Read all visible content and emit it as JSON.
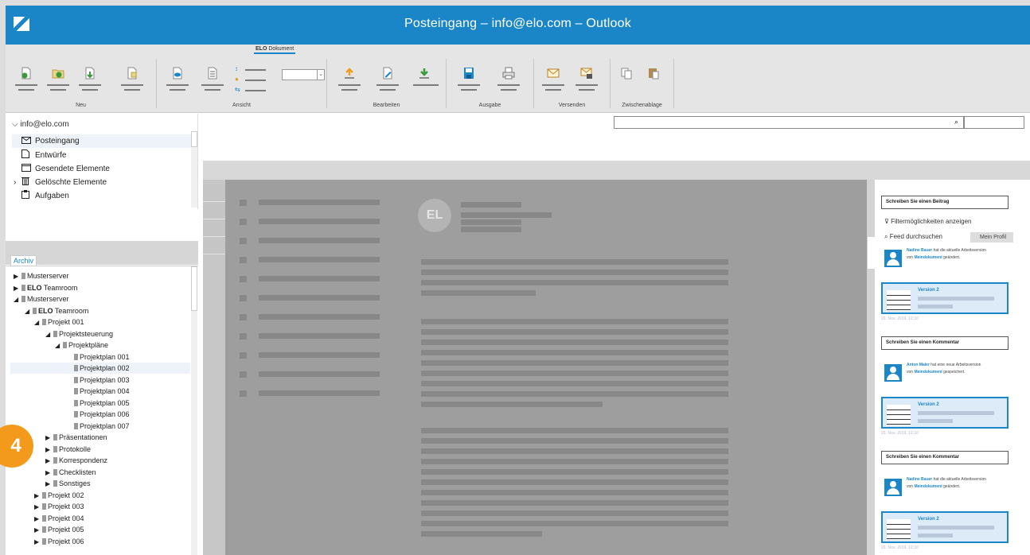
{
  "window": {
    "title": "Posteingang – info@elo.com – Outlook"
  },
  "ribbon": {
    "tab_bold": "ELO",
    "tab_rest": " Dokument",
    "groups": [
      "Neu",
      "Ansicht",
      "Bearbeiten",
      "Ausgabe",
      "Versenden",
      "Zwischenablage"
    ]
  },
  "folders": {
    "account": "info@elo.com",
    "items": [
      "Posteingang",
      "Entwürfe",
      "Gesendete Elemente",
      "Gelöschte Elemente",
      "Aufgaben"
    ]
  },
  "archive": {
    "tab": "Archiv",
    "tree": [
      {
        "label": "Musterserver",
        "bold": "",
        "arrow": "▶",
        "level": 0
      },
      {
        "label": " Teamroom",
        "bold": "ELO",
        "arrow": "▶",
        "level": 0
      },
      {
        "label": "Musterserver",
        "bold": "",
        "arrow": "◢",
        "level": 1
      },
      {
        "label": " Teamroom",
        "bold": "ELO",
        "arrow": "◢",
        "level": 2
      },
      {
        "label": "Projekt 001",
        "bold": "",
        "arrow": "◢",
        "level": 3
      },
      {
        "label": "Projektsteuerung",
        "bold": "",
        "arrow": "◢",
        "level": 4
      },
      {
        "label": "Projektpläne",
        "bold": "",
        "arrow": "◢",
        "level": 5
      },
      {
        "label": "Projektplan 001",
        "bold": "",
        "arrow": "",
        "level": 6
      },
      {
        "label": "Projektplan 002",
        "bold": "",
        "arrow": "",
        "level": 6
      },
      {
        "label": "Projektplan 003",
        "bold": "",
        "arrow": "",
        "level": 6
      },
      {
        "label": "Projektplan 004",
        "bold": "",
        "arrow": "",
        "level": 6
      },
      {
        "label": "Projektplan 005",
        "bold": "",
        "arrow": "",
        "level": 6
      },
      {
        "label": "Projektplan 006",
        "bold": "",
        "arrow": "",
        "level": 6
      },
      {
        "label": "Projektplan 007",
        "bold": "",
        "arrow": "",
        "level": 6
      },
      {
        "label": "Präsentationen",
        "bold": "",
        "arrow": "▶",
        "level": 4
      },
      {
        "label": "Protokolle",
        "bold": "",
        "arrow": "▶",
        "level": 4
      },
      {
        "label": "Korrespondenz",
        "bold": "",
        "arrow": "▶",
        "level": 4
      },
      {
        "label": "Checklisten",
        "bold": "",
        "arrow": "▶",
        "level": 4
      },
      {
        "label": "Sonstiges",
        "bold": "",
        "arrow": "▶",
        "level": 4
      },
      {
        "label": "Projekt 002",
        "bold": "",
        "arrow": "▶",
        "level": 3
      },
      {
        "label": "Projekt 003",
        "bold": "",
        "arrow": "▶",
        "level": 3
      },
      {
        "label": "Projekt 004",
        "bold": "",
        "arrow": "▶",
        "level": 3
      },
      {
        "label": "Projekt 005",
        "bold": "",
        "arrow": "▶",
        "level": 3
      },
      {
        "label": "Projekt 006",
        "bold": "",
        "arrow": "▶",
        "level": 3
      }
    ]
  },
  "preview": {
    "avatar": "EL"
  },
  "feed": {
    "write_post": "Schreiben Sie einen Beitrag",
    "filter": "Filtermöglichkeiten anzeigen",
    "search": "Feed durchsuchen",
    "profile": "Mein Profil",
    "posts": [
      {
        "user": "Nadine Bauer",
        "t1": " hat die aktuelle Arbeitsversion",
        "t2": "von ",
        "doc": "Meindokument",
        "t3": " geändert.",
        "version": "Version 2",
        "date": "20. Nov. 2019, 12:10",
        "comment": "Schreiben Sie einen Kommentar"
      },
      {
        "user": "Anton Maier",
        "t1": " hat eine neue Arbeitsversion",
        "t2": "von ",
        "doc": "Meindokument",
        "t3": " gespeichert.",
        "version": "Version 2",
        "date": "20. Nov. 2019, 12:10",
        "comment": "Schreiben Sie einen Kommentar"
      },
      {
        "user": "Nadine Bauer",
        "t1": " hat die aktuelle Arbeitsversion",
        "t2": "von ",
        "doc": "Meindokument",
        "t3": " geändert.",
        "version": "Version 2",
        "date": "20. Nov. 2019, 12:10",
        "comment": ""
      }
    ]
  },
  "step_badge": "4",
  "colors": {
    "accent": "#1a86c8",
    "badge": "#f39a1d"
  }
}
